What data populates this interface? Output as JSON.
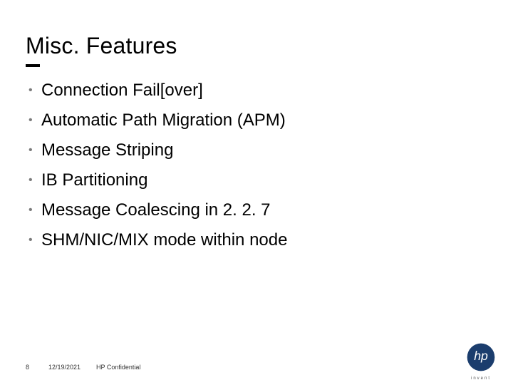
{
  "title": "Misc. Features",
  "bullets": [
    "Connection Fail[over]",
    "Automatic Path Migration (APM)",
    "Message Striping",
    "IB Partitioning",
    "Message Coalescing in 2. 2. 7",
    "SHM/NIC/MIX mode within node"
  ],
  "footer": {
    "page": "8",
    "date": "12/19/2021",
    "confidential": "HP Confidential"
  },
  "logo": {
    "brand_letters": "hp",
    "tagline": "invent"
  }
}
